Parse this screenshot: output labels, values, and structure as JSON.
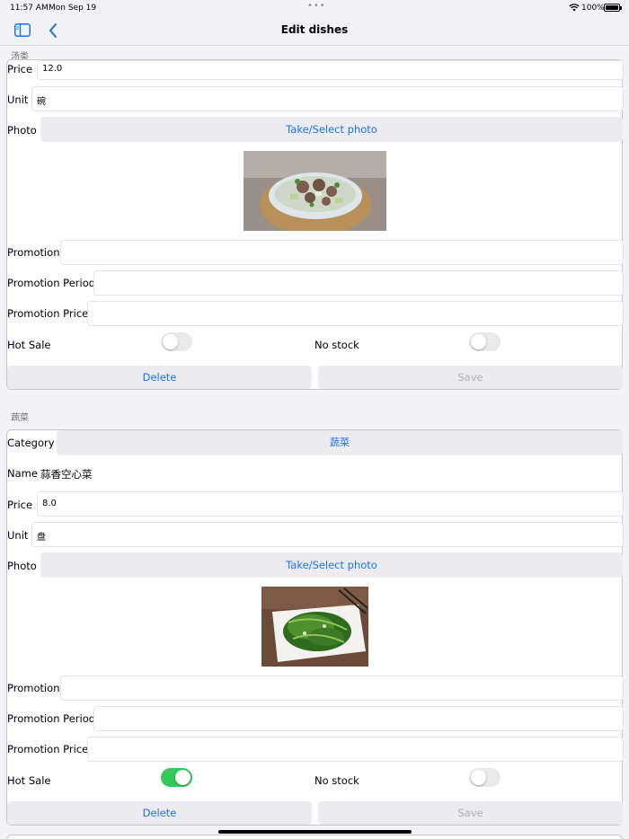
{
  "status": {
    "time": "11:57 AM",
    "date": "Mon Sep 19",
    "dots": "•••",
    "battery": "100%"
  },
  "nav": {
    "title": "Edit dishes"
  },
  "cards": [
    {
      "section": "汤类",
      "price_label": "Price",
      "price": "12.0",
      "unit_label": "Unit",
      "unit": "碗",
      "photo_label": "Photo",
      "photo_button": "Take/Select photo",
      "promotion_label": "Promotion",
      "promotion": "",
      "promotion_period_label": "Promotion Period",
      "promotion_period": "",
      "promotion_price_label": "Promotion Price",
      "promotion_price": "",
      "hot_sale_label": "Hot Sale",
      "hot_sale": false,
      "no_stock_label": "No stock",
      "no_stock": false,
      "delete_label": "Delete",
      "save_label": "Save"
    },
    {
      "section": "蔬菜",
      "category_label": "Category",
      "category": "蔬菜",
      "name_label": "Name",
      "name": "蒜香空心菜",
      "price_label": "Price",
      "price": "8.0",
      "unit_label": "Unit",
      "unit": "盘",
      "photo_label": "Photo",
      "photo_button": "Take/Select photo",
      "promotion_label": "Promotion",
      "promotion": "",
      "promotion_period_label": "Promotion Period",
      "promotion_period": "",
      "promotion_price_label": "Promotion Price",
      "promotion_price": "",
      "hot_sale_label": "Hot Sale",
      "hot_sale": true,
      "no_stock_label": "No stock",
      "no_stock": false,
      "delete_label": "Delete",
      "save_label": "Save"
    }
  ],
  "colors": {
    "accent": "#1a73e8",
    "toggle_on": "#34c759"
  }
}
